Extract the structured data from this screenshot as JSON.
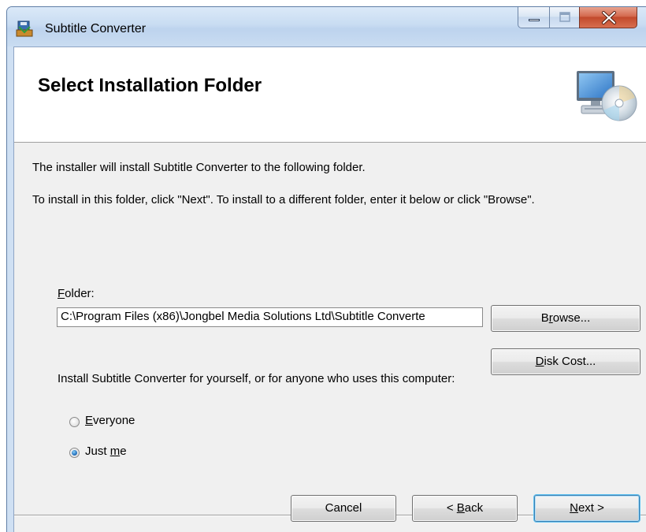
{
  "window": {
    "title": "Subtitle Converter",
    "icons": {
      "app": "installer-icon",
      "minimize": "minimize-icon",
      "maximize": "maximize-icon",
      "close": "close-icon"
    }
  },
  "banner": {
    "title": "Select Installation Folder",
    "icon": "computer-cd-icon"
  },
  "intro": {
    "line1": "The installer will install Subtitle Converter to the following folder.",
    "line2": "To install in this folder, click \"Next\". To install to a different folder, enter it below or click \"Browse\"."
  },
  "folder": {
    "label_mnemonic": "F",
    "label_rest": "older:",
    "value": "C:\\Program Files (x86)\\Jongbel Media Solutions Ltd\\Subtitle Converte"
  },
  "buttons": {
    "browse": {
      "pre": "B",
      "mnemonic": "r",
      "post": "owse..."
    },
    "disk_cost": {
      "pre": "",
      "mnemonic": "D",
      "post": "isk Cost..."
    },
    "cancel": "Cancel",
    "back": {
      "pre": "< ",
      "mnemonic": "B",
      "post": "ack"
    },
    "next": {
      "pre": "",
      "mnemonic": "N",
      "post": "ext >"
    }
  },
  "install_for": {
    "prompt": "Install Subtitle Converter for yourself, or for anyone who uses this computer:",
    "options": [
      {
        "pre": "",
        "mnemonic": "E",
        "post": "veryone",
        "selected": false
      },
      {
        "pre": "Just ",
        "mnemonic": "m",
        "post": "e",
        "selected": true
      }
    ]
  },
  "colors": {
    "title_bar": "#c8dcf2",
    "close_button": "#c24a2c",
    "dialog_background": "#f0f0f0",
    "banner_background": "#ffffff",
    "default_button_border": "#3c7fb1"
  }
}
